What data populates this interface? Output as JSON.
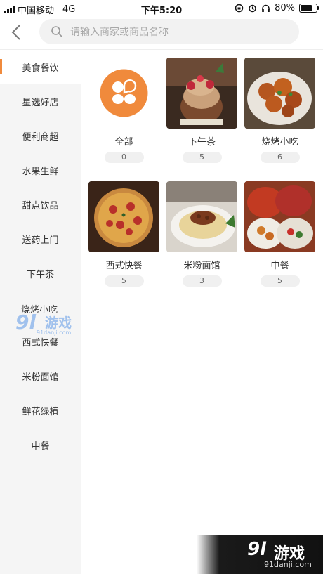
{
  "status_bar": {
    "carrier": "中国移动",
    "network": "4G",
    "time": "下午5:20",
    "battery": "80%",
    "battery_level": 0.8
  },
  "header": {
    "search_placeholder": "请输入商家或商品名称"
  },
  "sidebar": {
    "items": [
      {
        "label": "美食餐饮",
        "active": true
      },
      {
        "label": "星选好店"
      },
      {
        "label": "便利商超"
      },
      {
        "label": "水果生鲜"
      },
      {
        "label": "甜点饮品"
      },
      {
        "label": "送药上门"
      },
      {
        "label": "下午茶"
      },
      {
        "label": "西式快餐"
      },
      {
        "label": "米粉面馆"
      },
      {
        "label": "鲜花绿植"
      },
      {
        "label": "中餐"
      }
    ]
  },
  "grid": {
    "items": [
      {
        "name": "全部",
        "count": "0"
      },
      {
        "name": "下午茶",
        "count": "5"
      },
      {
        "name": "烧烤小吃",
        "count": "6"
      },
      {
        "name": "西式快餐",
        "count": "5"
      },
      {
        "name": "米粉面馆",
        "count": "3"
      },
      {
        "name": "中餐",
        "count": "5"
      }
    ]
  },
  "colors": {
    "accent": "#f08a3c"
  },
  "watermarks": {
    "overlay": {
      "logo": "9l",
      "text": "游戏",
      "url": "91danji.com",
      "extra": "烧烤小吃"
    },
    "corner": {
      "logo": "9l",
      "text": "游戏",
      "url": "91danji.com"
    }
  }
}
